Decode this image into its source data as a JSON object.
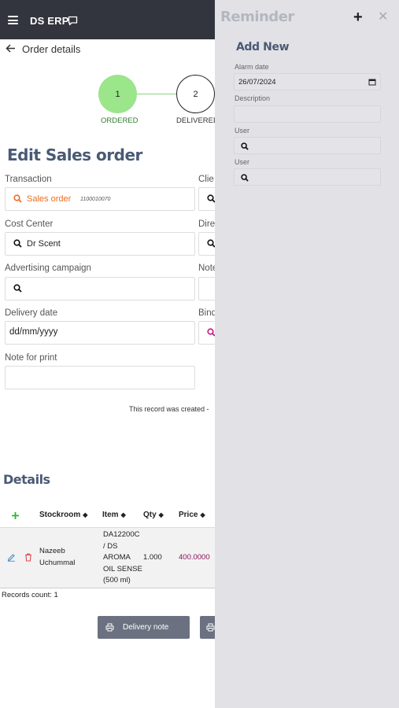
{
  "header": {
    "app_title": "DS ERP"
  },
  "breadcrumb": {
    "title": "Order details"
  },
  "stepper": {
    "steps": [
      {
        "number": "1",
        "label": "ORDERED"
      },
      {
        "number": "2",
        "label": "DELIVERED"
      }
    ]
  },
  "form": {
    "title": "Edit Sales order",
    "transaction_label": "Transaction",
    "transaction_value": "Sales order",
    "transaction_number": "1100010070",
    "client_label": "Clie",
    "cost_center_label": "Cost Center",
    "cost_center_value": "Dr Scent",
    "direction_label": "Dire",
    "advertising_label": "Advertising campaign",
    "note_label": "Note",
    "delivery_date_label": "Delivery date",
    "delivery_date_placeholder": "dd/mm/yyyy",
    "binding_label": "Bind",
    "note_print_label": "Note for print",
    "created_text": "This record was created -"
  },
  "details": {
    "title": "Details",
    "columns": [
      "Stockroom",
      "Item",
      "Qty",
      "Price"
    ],
    "rows": [
      {
        "stockroom": "Nazeeb Uchummal",
        "item_lines": [
          "DA12200C",
          "/ DS",
          "AROMA",
          "OIL SENSE",
          "(500 ml)"
        ],
        "qty": "1.000",
        "price": "400.0000"
      }
    ],
    "records_count": "Records count: 1"
  },
  "buttons": {
    "delivery_note": "Delivery note"
  },
  "reminder": {
    "title": "Reminder",
    "add_new": "Add New",
    "alarm_date_label": "Alarm date",
    "alarm_date_value": "26/07/2024",
    "description_label": "Description",
    "user_label_1": "User",
    "user_label_2": "User"
  },
  "colors": {
    "topbar": "#32353d",
    "accent_orange": "#f26b1d",
    "price_purple": "#8a1457",
    "step_done": "#9be58b",
    "panel_bg": "#e2e2e6"
  },
  "icons": [
    "menu-icon",
    "chat-icon",
    "back-arrow-icon",
    "search-icon",
    "plus-icon",
    "sort-icon",
    "edit-icon",
    "trash-icon",
    "print-icon",
    "calendar-icon",
    "close-icon"
  ]
}
